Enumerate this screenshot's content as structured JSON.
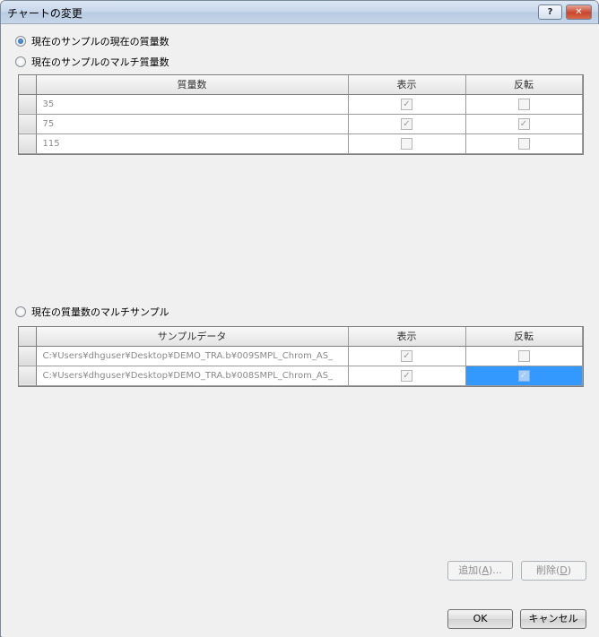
{
  "window": {
    "title": "チャートの変更",
    "help_label": "?",
    "close_label": "✕"
  },
  "options": {
    "current_sample_current_mass": "現在のサンプルの現在の質量数",
    "current_sample_multi_mass": "現在のサンプルのマルチ質量数",
    "current_mass_multi_sample": "現在の質量数のマルチサンプル",
    "selected": "current_sample_current_mass"
  },
  "mass_table": {
    "columns": [
      "質量数",
      "表示",
      "反転"
    ],
    "rows": [
      {
        "mass": "35",
        "show": "✓",
        "invert": ""
      },
      {
        "mass": "75",
        "show": "✓",
        "invert": "✓"
      },
      {
        "mass": "115",
        "show": "",
        "invert": ""
      }
    ]
  },
  "sample_table": {
    "columns": [
      "サンプルデータ",
      "表示",
      "反転"
    ],
    "rows": [
      {
        "path": "C:¥Users¥dhguser¥Desktop¥DEMO_TRA.b¥009SMPL_Chrom_AS_",
        "show": "✓",
        "invert": ""
      },
      {
        "path": "C:¥Users¥dhguser¥Desktop¥DEMO_TRA.b¥008SMPL_Chrom_AS_",
        "show": "✓",
        "invert": "✓"
      }
    ]
  },
  "buttons": {
    "add": {
      "label": "追加(",
      "key": "A",
      "suffix": ")..."
    },
    "delete": {
      "label": "削除(",
      "key": "D",
      "suffix": ")"
    },
    "ok": "OK",
    "cancel": "キャンセル"
  }
}
